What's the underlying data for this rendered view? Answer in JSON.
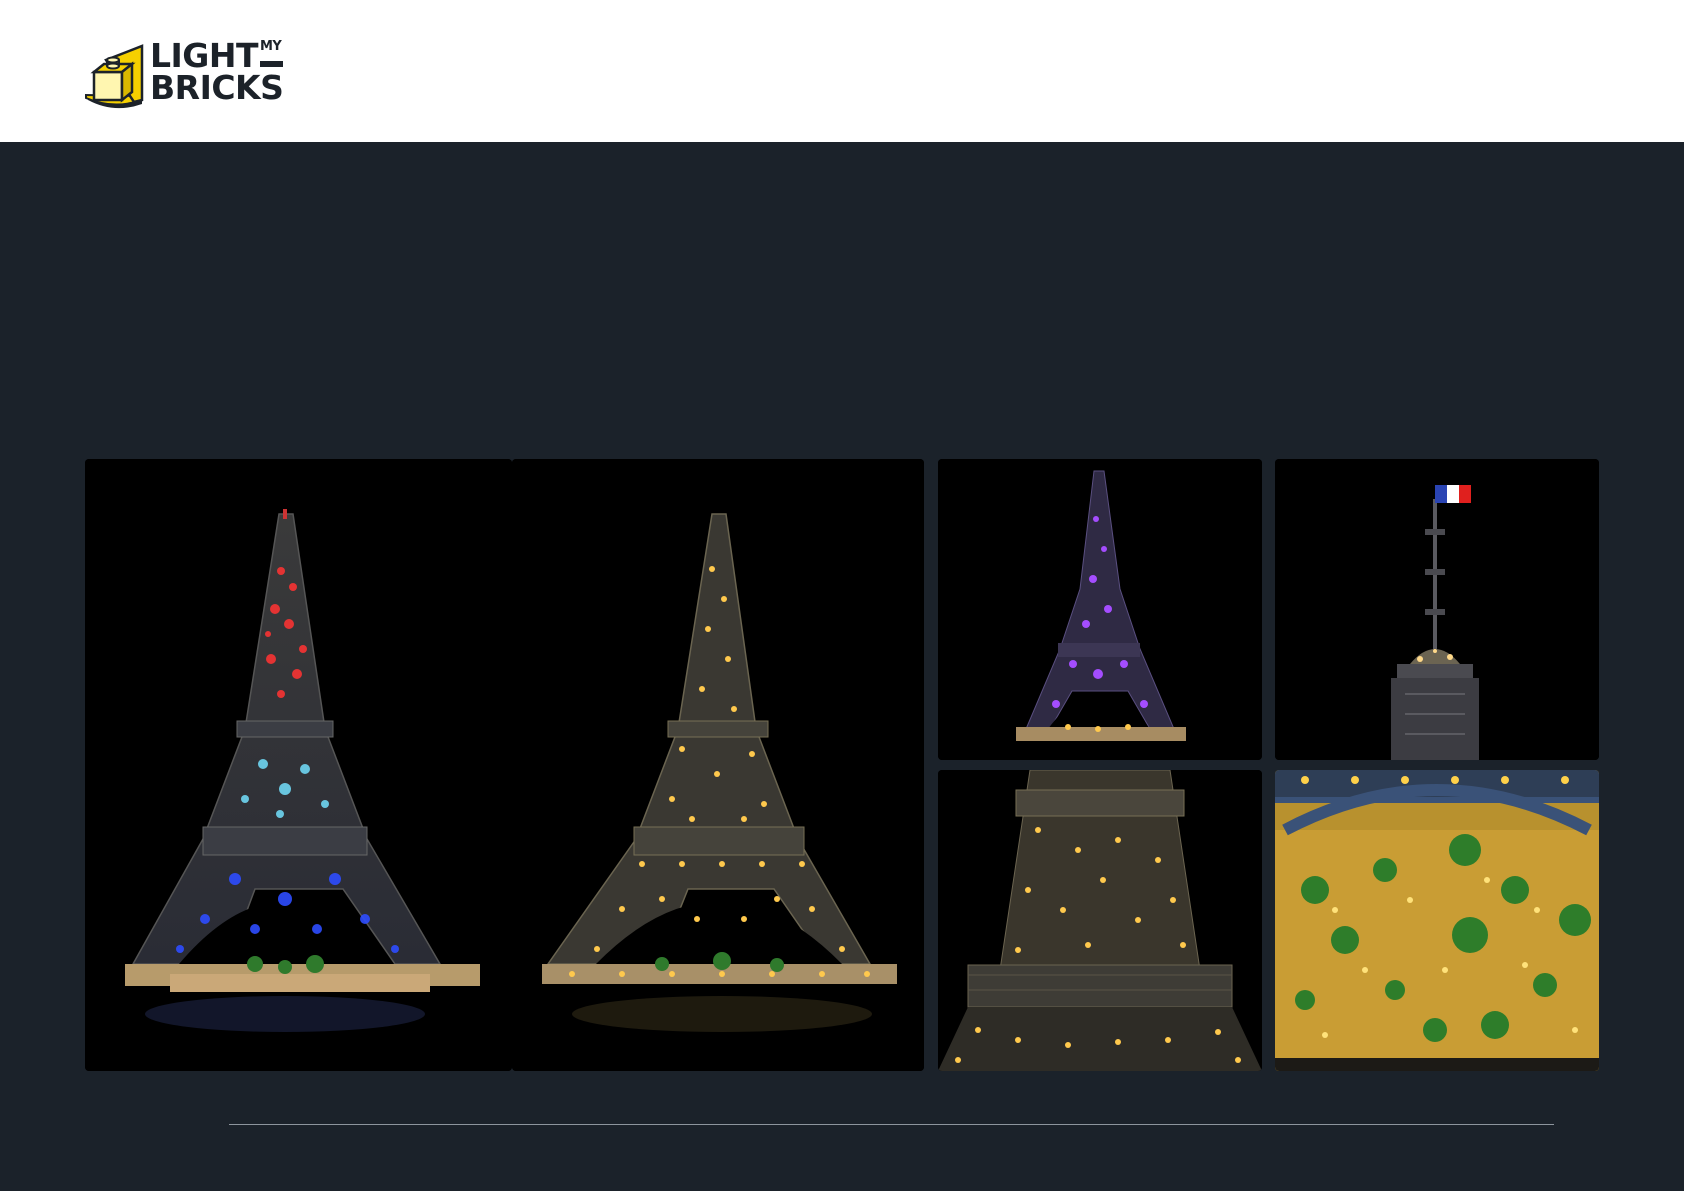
{
  "brand": {
    "line1": "LIGHT",
    "line2": "BRICKS",
    "my": "MY",
    "colors": {
      "yellow": "#f5d000",
      "dark": "#1c2229"
    }
  },
  "page": {
    "background": "#1b222a",
    "header_background": "#ffffff"
  },
  "gallery": {
    "images": [
      {
        "subject": "eiffel-tower-tricolor-lighting",
        "flag_colors": [
          "#e0201e",
          "#ffffff",
          "#2c4fd8"
        ]
      },
      {
        "subject": "eiffel-tower-warm-white-lighting"
      },
      {
        "subject": "eiffel-tower-purple-lighting"
      },
      {
        "subject": "eiffel-tower-summit-french-flag",
        "flag_colors": [
          "#2a44b3",
          "#ffffff",
          "#e0201e"
        ]
      },
      {
        "subject": "eiffel-tower-middle-level-closeup"
      },
      {
        "subject": "champ-de-mars-garden-closeup"
      }
    ]
  }
}
